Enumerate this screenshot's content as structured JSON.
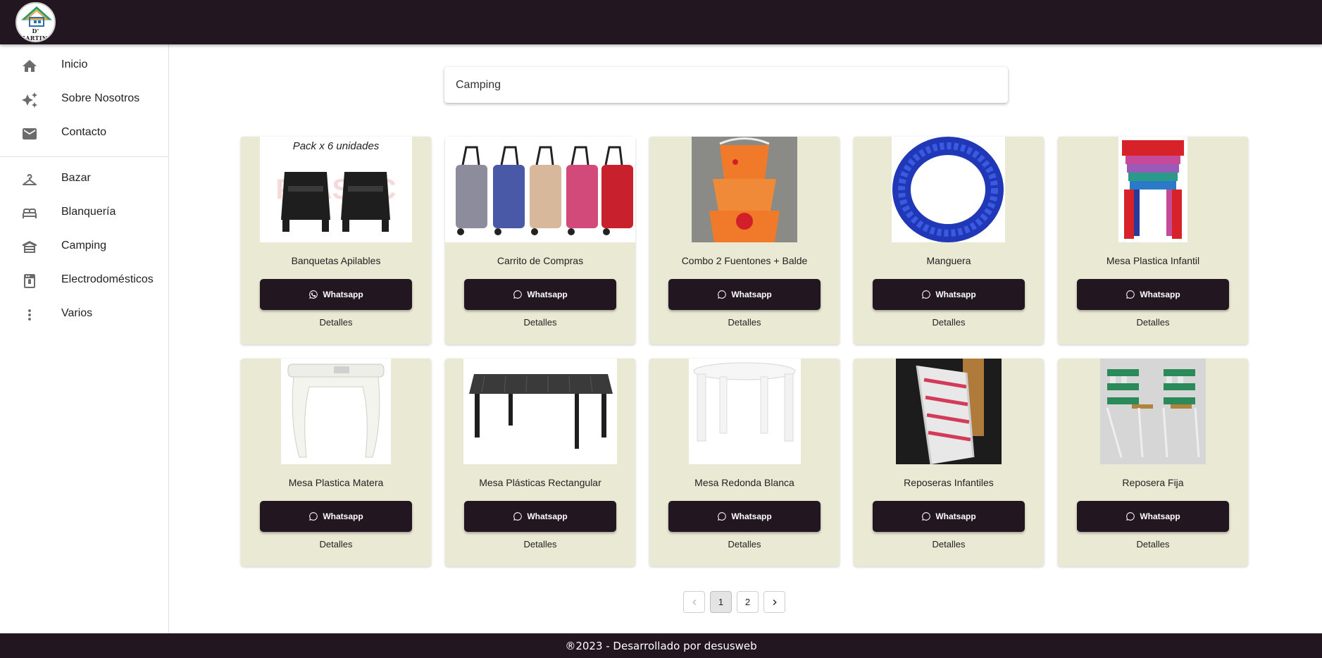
{
  "brand": {
    "logo_text": "D' MARTINA"
  },
  "sidebar": {
    "primary": [
      {
        "label": "Inicio",
        "icon": "home-icon"
      },
      {
        "label": "Sobre Nosotros",
        "icon": "sparkles-icon"
      },
      {
        "label": "Contacto",
        "icon": "mail-icon"
      }
    ],
    "categories": [
      {
        "label": "Bazar",
        "icon": "hanger-icon"
      },
      {
        "label": "Blanquería",
        "icon": "bed-icon"
      },
      {
        "label": "Camping",
        "icon": "tent-icon"
      },
      {
        "label": "Electrodomésticos",
        "icon": "appliance-icon"
      },
      {
        "label": "Varios",
        "icon": "more-vert-icon"
      }
    ]
  },
  "search": {
    "value": "Camping"
  },
  "products": [
    {
      "title": "Banquetas Apilables",
      "button": "Whatsapp",
      "details": "Detalles",
      "image_caption": "Pack x 6 unidades"
    },
    {
      "title": "Carrito de Compras",
      "button": "Whatsapp",
      "details": "Detalles"
    },
    {
      "title": "Combo 2 Fuentones + Balde",
      "button": "Whatsapp",
      "details": "Detalles"
    },
    {
      "title": "Manguera",
      "button": "Whatsapp",
      "details": "Detalles"
    },
    {
      "title": "Mesa Plastica Infantil",
      "button": "Whatsapp",
      "details": "Detalles"
    },
    {
      "title": "Mesa Plastica Matera",
      "button": "Whatsapp",
      "details": "Detalles"
    },
    {
      "title": "Mesa Plásticas Rectangular",
      "button": "Whatsapp",
      "details": "Detalles"
    },
    {
      "title": "Mesa Redonda Blanca",
      "button": "Whatsapp",
      "details": "Detalles"
    },
    {
      "title": "Reposeras Infantiles",
      "button": "Whatsapp",
      "details": "Detalles"
    },
    {
      "title": "Reposera Fija",
      "button": "Whatsapp",
      "details": "Detalles"
    }
  ],
  "pagination": {
    "pages": [
      "1",
      "2"
    ],
    "current": "1"
  },
  "footer": {
    "text": "®2023 - Desarrollado por desusweb"
  },
  "colors": {
    "dark": "#221621",
    "card_bg": "#eae9d4"
  }
}
